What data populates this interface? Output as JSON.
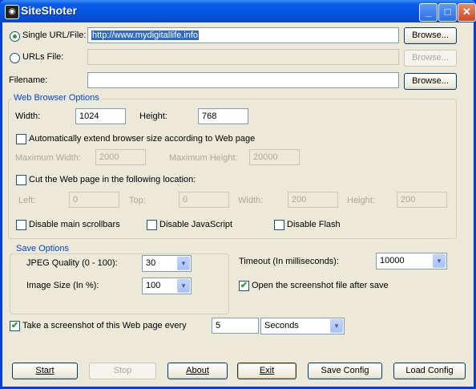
{
  "window": {
    "title": "SiteShoter",
    "min": "_",
    "max": "□",
    "close": "✕"
  },
  "source": {
    "single_url_label": "Single URL/File:",
    "single_url_value": "http://www.mydigitallife.info",
    "urls_file_label": "URLs File:",
    "urls_file_value": "",
    "filename_label": "Filename:",
    "filename_value": "",
    "browse_label": "Browse..."
  },
  "browser": {
    "group_label": "Web Browser Options",
    "width_label": "Width:",
    "width_value": "1024",
    "height_label": "Height:",
    "height_value": "768",
    "auto_extend_label": "Automatically extend browser size according to Web page",
    "max_width_label": "Maximum Width:",
    "max_width_value": "2000",
    "max_height_label": "Maximum Height:",
    "max_height_value": "20000",
    "cut_label": "Cut the Web page in the following location:",
    "left_label": "Left:",
    "left_value": "0",
    "top_label": "Top:",
    "top_value": "0",
    "cut_width_label": "Width:",
    "cut_width_value": "200",
    "cut_height_label": "Height:",
    "cut_height_value": "200",
    "disable_scrollbars_label": "Disable main scrollbars",
    "disable_js_label": "Disable JavaScript",
    "disable_flash_label": "Disable Flash"
  },
  "save": {
    "group_label": "Save Options",
    "jpeg_label": "JPEG Quality (0 - 100):",
    "jpeg_value": "30",
    "image_size_label": "Image Size (In %):",
    "image_size_value": "100",
    "timeout_label": "Timeout (In milliseconds):",
    "timeout_value": "10000",
    "open_after_label": "Open the screenshot file after save"
  },
  "schedule": {
    "label": "Take a screenshot of this Web page every",
    "interval_value": "5",
    "unit_value": "Seconds"
  },
  "buttons": {
    "start": "Start",
    "stop": "Stop",
    "about": "About",
    "exit": "Exit",
    "save_config": "Save Config",
    "load_config": "Load Config"
  },
  "icons": {
    "check": "✔",
    "dropdown": "▼",
    "app": "◉"
  }
}
